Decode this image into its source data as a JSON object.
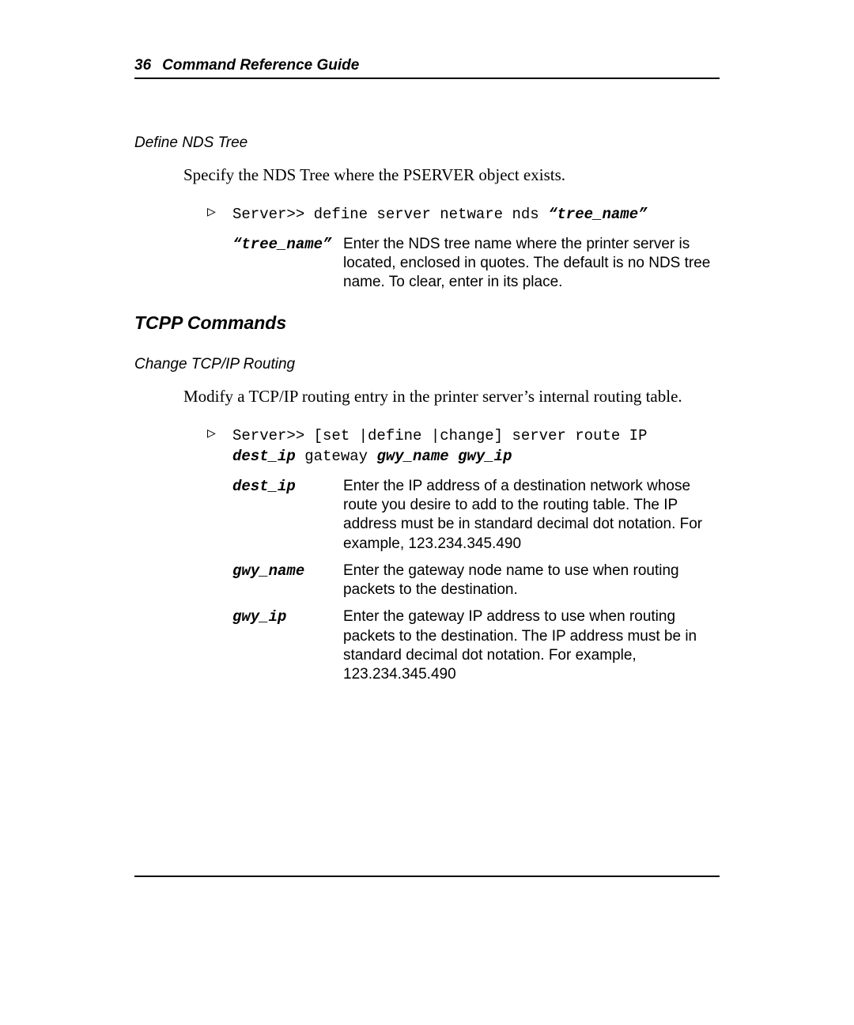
{
  "header": {
    "page_number": "36",
    "title": "Command Reference Guide"
  },
  "section1": {
    "subhead": "Define NDS Tree",
    "body": "Specify the NDS Tree where the PSERVER object exists.",
    "command_prefix": "Server>> define server netware nds ",
    "command_param": "“tree_name”",
    "params": [
      {
        "key": "“tree_name”",
        "val": "Enter the NDS tree name where the printer server is located, enclosed in quotes.  The default is no NDS tree name.  To clear, enter in its place."
      }
    ]
  },
  "section2": {
    "heading": "TCPP Commands",
    "subhead": "Change TCP/IP Routing",
    "body": "Modify a TCP/IP routing entry in the printer server’s internal routing table.",
    "cmd_line1_plain": "Server>> [set |define |change] server route IP",
    "cmd_line2_seg1": "dest_ip",
    "cmd_line2_seg2": " gateway ",
    "cmd_line2_seg3": "gwy_name gwy_ip",
    "params": [
      {
        "key": "dest_ip",
        "val": "Enter the IP address of a destination network whose route you desire to add to the routing table.  The IP address must be in standard decimal dot notation.  For example, 123.234.345.490"
      },
      {
        "key": "gwy_name",
        "val": "Enter the gateway node name to use when routing packets to the destination."
      },
      {
        "key": "gwy_ip",
        "val": "Enter the gateway IP address to use when routing packets to the destination.  The IP address must be in standard decimal dot notation.  For example, 123.234.345.490"
      }
    ]
  }
}
